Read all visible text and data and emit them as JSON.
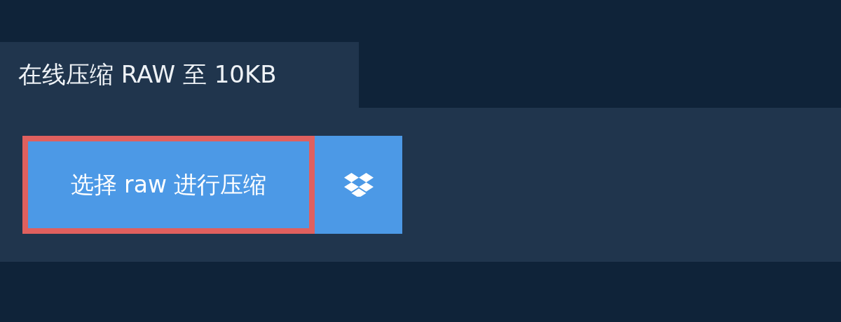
{
  "tab": {
    "label": "在线压缩 RAW 至 10KB"
  },
  "upload_button": {
    "label": "选择 raw 进行压缩",
    "focused": true
  }
}
